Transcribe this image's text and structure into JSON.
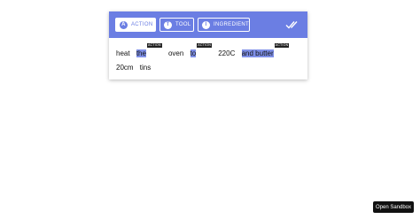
{
  "colors": {
    "accent": "#6b7ee3",
    "highlight": "#7f90e8",
    "tag_bg": "#222222"
  },
  "toolbar": {
    "chips": [
      {
        "badge": "A",
        "label": "ACTION",
        "selected": true
      },
      {
        "badge": "T",
        "label": "TOOL",
        "selected": false
      },
      {
        "badge": "I",
        "label": "INGREDIENT",
        "selected": false
      }
    ],
    "confirm_icon": "double-check-icon"
  },
  "tokens": [
    {
      "text": "heat"
    },
    {
      "text": "the",
      "highlight": true,
      "tag": "ACTION"
    },
    {
      "text": "oven"
    },
    {
      "text": "to",
      "highlight": true,
      "tag": "ACTION"
    },
    {
      "text": "220C"
    },
    {
      "text": "and butter",
      "highlight": true,
      "tag": "ACTION"
    },
    {
      "text": "20cm"
    },
    {
      "text": "tins"
    }
  ],
  "sandbox_button": "Open Sandbox"
}
